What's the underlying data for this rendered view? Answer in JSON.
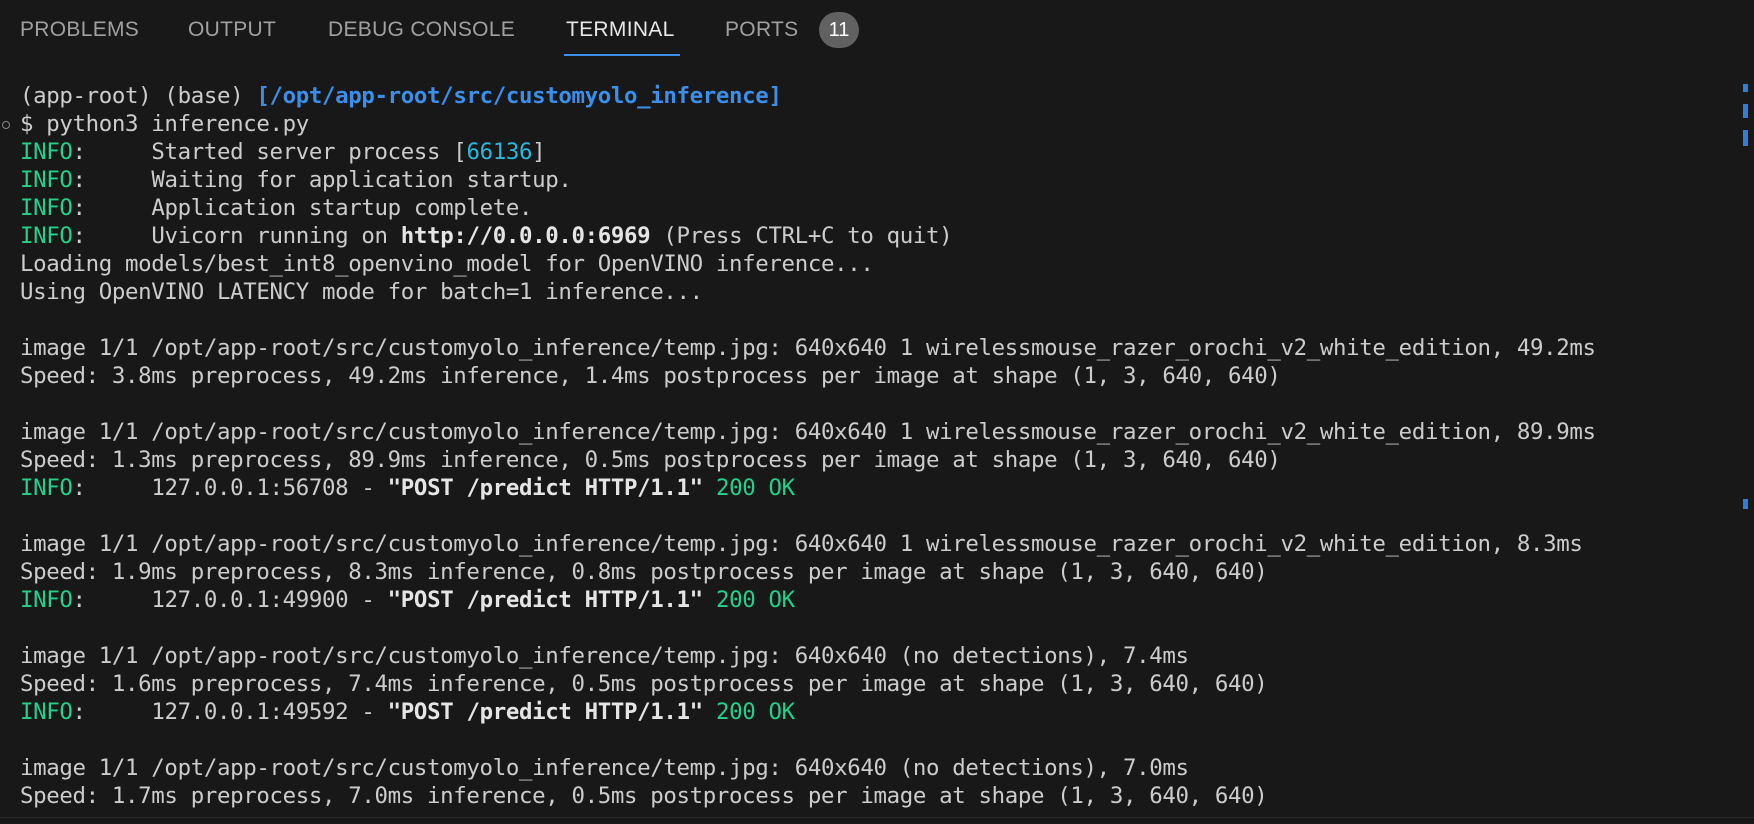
{
  "tabs": {
    "problems": "PROBLEMS",
    "output": "OUTPUT",
    "debug_console": "DEBUG CONSOLE",
    "terminal": "TERMINAL",
    "ports": "PORTS",
    "ports_badge": "11"
  },
  "terminal": {
    "prompt": {
      "env": "(app-root) (base) ",
      "cwd": "[/opt/app-root/src/customyolo_inference]"
    },
    "command": "$ python3 inference.py",
    "l3": {
      "tag": "INFO",
      "pre": ":     Started server process [",
      "pid": "66136",
      "post": "]"
    },
    "l4": {
      "tag": "INFO",
      "text": ":     Waiting for application startup."
    },
    "l5": {
      "tag": "INFO",
      "text": ":     Application startup complete."
    },
    "l6": {
      "tag": "INFO",
      "pre": ":     Uvicorn running on ",
      "url": "http://0.0.0.0:6969",
      "post": " (Press CTRL+C to quit)"
    },
    "l7": "Loading models/best_int8_openvino_model for OpenVINO inference...",
    "l8": "Using OpenVINO LATENCY mode for batch=1 inference...",
    "l10": "image 1/1 /opt/app-root/src/customyolo_inference/temp.jpg: 640x640 1 wirelessmouse_razer_orochi_v2_white_edition, 49.2ms",
    "l11": "Speed: 3.8ms preprocess, 49.2ms inference, 1.4ms postprocess per image at shape (1, 3, 640, 640)",
    "l13": "image 1/1 /opt/app-root/src/customyolo_inference/temp.jpg: 640x640 1 wirelessmouse_razer_orochi_v2_white_edition, 89.9ms",
    "l14": "Speed: 1.3ms preprocess, 89.9ms inference, 0.5ms postprocess per image at shape (1, 3, 640, 640)",
    "l15": {
      "tag": "INFO",
      "pre": ":     127.0.0.1:56708 - ",
      "req": "\"POST /predict HTTP/1.1\"",
      "status": " 200 OK"
    },
    "l17": "image 1/1 /opt/app-root/src/customyolo_inference/temp.jpg: 640x640 1 wirelessmouse_razer_orochi_v2_white_edition, 8.3ms",
    "l18": "Speed: 1.9ms preprocess, 8.3ms inference, 0.8ms postprocess per image at shape (1, 3, 640, 640)",
    "l19": {
      "tag": "INFO",
      "pre": ":     127.0.0.1:49900 - ",
      "req": "\"POST /predict HTTP/1.1\"",
      "status": " 200 OK"
    },
    "l21": "image 1/1 /opt/app-root/src/customyolo_inference/temp.jpg: 640x640 (no detections), 7.4ms",
    "l22": "Speed: 1.6ms preprocess, 7.4ms inference, 0.5ms postprocess per image at shape (1, 3, 640, 640)",
    "l23": {
      "tag": "INFO",
      "pre": ":     127.0.0.1:49592 - ",
      "req": "\"POST /predict HTTP/1.1\"",
      "status": " 200 OK"
    },
    "l25": "image 1/1 /opt/app-root/src/customyolo_inference/temp.jpg: 640x640 (no detections), 7.0ms",
    "l26": "Speed: 1.7ms preprocess, 7.0ms inference, 0.5ms postprocess per image at shape (1, 3, 640, 640)"
  },
  "colors": {
    "background": "#181818",
    "info_green": "#23d18b",
    "path_blue": "#3b8eea",
    "pid_cyan": "#29b8db",
    "text": "#cccccc",
    "active_tab_underline": "#3b8eea"
  }
}
